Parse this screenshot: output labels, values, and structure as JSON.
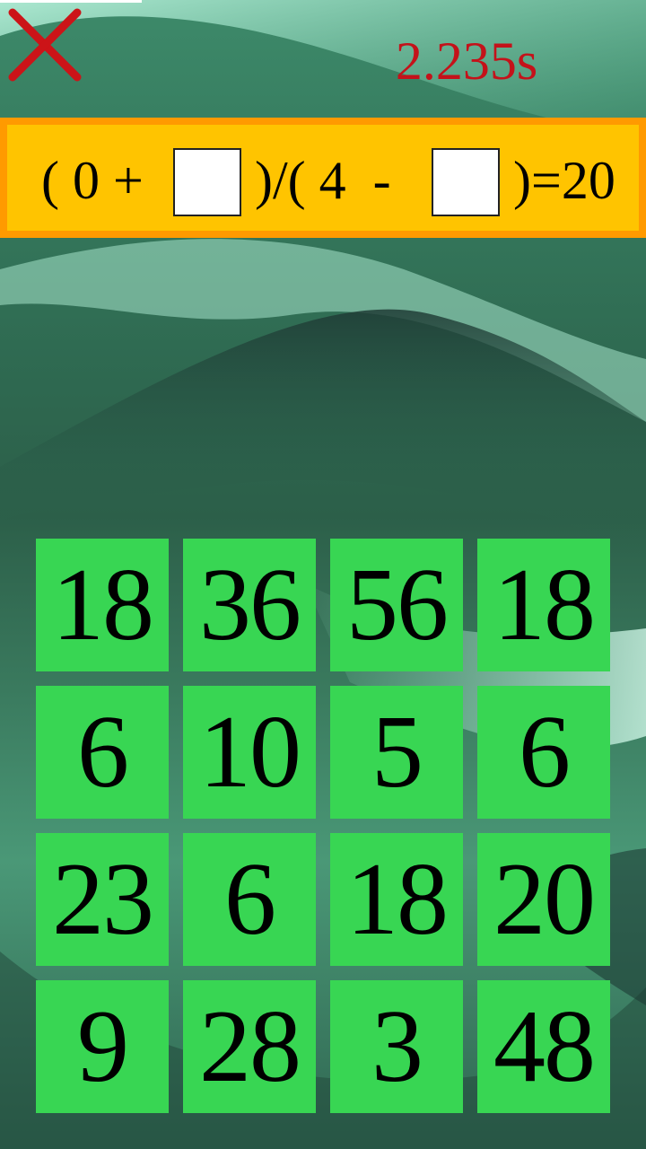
{
  "game": {
    "timer": "2.235s"
  },
  "equation": {
    "part1": "( 0 +",
    "part2": ")/( 4  -",
    "part3": ")=20"
  },
  "tiles": [
    "18",
    "36",
    "56",
    "18",
    "6",
    "10",
    "5",
    "6",
    "23",
    "6",
    "18",
    "20",
    "9",
    "28",
    "3",
    "48"
  ],
  "colors": {
    "timer": "#c4121a",
    "equation_bar": "#ffc400",
    "equation_border": "#ff9a00",
    "tile": "#38d653",
    "close_icon": "#cc1418"
  },
  "icons": {
    "close": "close-icon"
  }
}
